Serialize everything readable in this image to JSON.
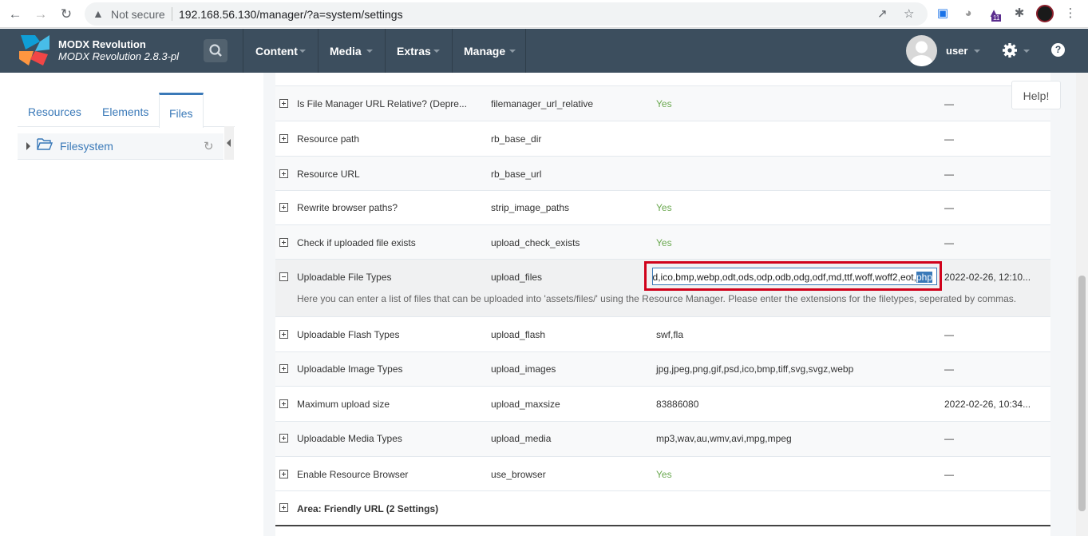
{
  "browser": {
    "security_label": "Not secure",
    "url": "192.168.56.130/manager/?a=system/settings",
    "badge": "11"
  },
  "topbar": {
    "brand_name": "MODX Revolution",
    "brand_version": "MODX Revolution 2.8.3-pl",
    "menus": [
      "Content",
      "Media",
      "Extras",
      "Manage"
    ],
    "username": "user",
    "help_glyph": "?"
  },
  "leftpanel": {
    "tabs": [
      "Resources",
      "Elements",
      "Files"
    ],
    "active_tab": "Files",
    "tree_root": "Filesystem"
  },
  "help_button": "Help!",
  "settings": [
    {
      "name": "Is File Manager URL Relative? (Depre...",
      "key": "filemanager_url_relative",
      "value": "Yes",
      "date": "—"
    },
    {
      "name": "Resource path",
      "key": "rb_base_dir",
      "value": "",
      "date": "—"
    },
    {
      "name": "Resource URL",
      "key": "rb_base_url",
      "value": "",
      "date": "—"
    },
    {
      "name": "Rewrite browser paths?",
      "key": "strip_image_paths",
      "value": "Yes",
      "date": "—"
    },
    {
      "name": "Check if uploaded file exists",
      "key": "upload_check_exists",
      "value": "Yes",
      "date": "—"
    },
    {
      "name": "Uploadable File Types",
      "key": "upload_files",
      "value_prefix": "d,ico,bmp,webp,odt,ods,odp,odb,odg,odf,md,ttf,woff,woff2,eot,",
      "value_selected": "php",
      "date": "2022-02-26, 12:10...",
      "description": "Here you can enter a list of files that can be uploaded into 'assets/files/' using the Resource Manager. Please enter the extensions for the filetypes, seperated by commas."
    },
    {
      "name": "Uploadable Flash Types",
      "key": "upload_flash",
      "value": "swf,fla",
      "date": "—"
    },
    {
      "name": "Uploadable Image Types",
      "key": "upload_images",
      "value": "jpg,jpeg,png,gif,psd,ico,bmp,tiff,svg,svgz,webp",
      "date": "—"
    },
    {
      "name": "Maximum upload size",
      "key": "upload_maxsize",
      "value": "83886080",
      "date": "2022-02-26, 10:34..."
    },
    {
      "name": "Uploadable Media Types",
      "key": "upload_media",
      "value": "mp3,wav,au,wmv,avi,mpg,mpeg",
      "date": "—"
    },
    {
      "name": "Enable Resource Browser",
      "key": "use_browser",
      "value": "Yes",
      "date": "—"
    }
  ],
  "area_row": "Area: Friendly URL (2 Settings)",
  "colors": {
    "topbar": "#3c4e5e",
    "accent": "#3a79b8",
    "yes": "#6aa84f",
    "highlight": "#d0021b"
  }
}
